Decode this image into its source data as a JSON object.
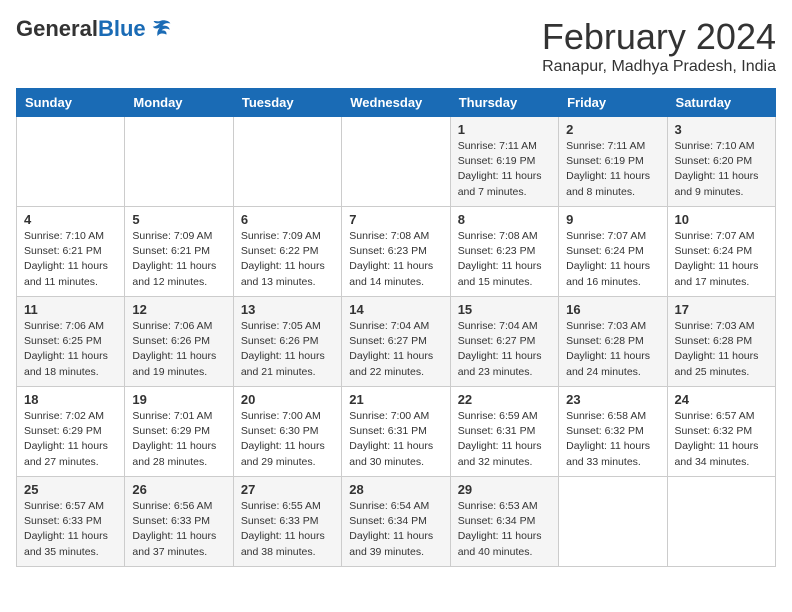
{
  "logo": {
    "general": "General",
    "blue": "Blue"
  },
  "title": "February 2024",
  "subtitle": "Ranapur, Madhya Pradesh, India",
  "days_of_week": [
    "Sunday",
    "Monday",
    "Tuesday",
    "Wednesday",
    "Thursday",
    "Friday",
    "Saturday"
  ],
  "weeks": [
    [
      {
        "day": "",
        "info": ""
      },
      {
        "day": "",
        "info": ""
      },
      {
        "day": "",
        "info": ""
      },
      {
        "day": "",
        "info": ""
      },
      {
        "day": "1",
        "info": "Sunrise: 7:11 AM\nSunset: 6:19 PM\nDaylight: 11 hours and 7 minutes."
      },
      {
        "day": "2",
        "info": "Sunrise: 7:11 AM\nSunset: 6:19 PM\nDaylight: 11 hours and 8 minutes."
      },
      {
        "day": "3",
        "info": "Sunrise: 7:10 AM\nSunset: 6:20 PM\nDaylight: 11 hours and 9 minutes."
      }
    ],
    [
      {
        "day": "4",
        "info": "Sunrise: 7:10 AM\nSunset: 6:21 PM\nDaylight: 11 hours and 11 minutes."
      },
      {
        "day": "5",
        "info": "Sunrise: 7:09 AM\nSunset: 6:21 PM\nDaylight: 11 hours and 12 minutes."
      },
      {
        "day": "6",
        "info": "Sunrise: 7:09 AM\nSunset: 6:22 PM\nDaylight: 11 hours and 13 minutes."
      },
      {
        "day": "7",
        "info": "Sunrise: 7:08 AM\nSunset: 6:23 PM\nDaylight: 11 hours and 14 minutes."
      },
      {
        "day": "8",
        "info": "Sunrise: 7:08 AM\nSunset: 6:23 PM\nDaylight: 11 hours and 15 minutes."
      },
      {
        "day": "9",
        "info": "Sunrise: 7:07 AM\nSunset: 6:24 PM\nDaylight: 11 hours and 16 minutes."
      },
      {
        "day": "10",
        "info": "Sunrise: 7:07 AM\nSunset: 6:24 PM\nDaylight: 11 hours and 17 minutes."
      }
    ],
    [
      {
        "day": "11",
        "info": "Sunrise: 7:06 AM\nSunset: 6:25 PM\nDaylight: 11 hours and 18 minutes."
      },
      {
        "day": "12",
        "info": "Sunrise: 7:06 AM\nSunset: 6:26 PM\nDaylight: 11 hours and 19 minutes."
      },
      {
        "day": "13",
        "info": "Sunrise: 7:05 AM\nSunset: 6:26 PM\nDaylight: 11 hours and 21 minutes."
      },
      {
        "day": "14",
        "info": "Sunrise: 7:04 AM\nSunset: 6:27 PM\nDaylight: 11 hours and 22 minutes."
      },
      {
        "day": "15",
        "info": "Sunrise: 7:04 AM\nSunset: 6:27 PM\nDaylight: 11 hours and 23 minutes."
      },
      {
        "day": "16",
        "info": "Sunrise: 7:03 AM\nSunset: 6:28 PM\nDaylight: 11 hours and 24 minutes."
      },
      {
        "day": "17",
        "info": "Sunrise: 7:03 AM\nSunset: 6:28 PM\nDaylight: 11 hours and 25 minutes."
      }
    ],
    [
      {
        "day": "18",
        "info": "Sunrise: 7:02 AM\nSunset: 6:29 PM\nDaylight: 11 hours and 27 minutes."
      },
      {
        "day": "19",
        "info": "Sunrise: 7:01 AM\nSunset: 6:29 PM\nDaylight: 11 hours and 28 minutes."
      },
      {
        "day": "20",
        "info": "Sunrise: 7:00 AM\nSunset: 6:30 PM\nDaylight: 11 hours and 29 minutes."
      },
      {
        "day": "21",
        "info": "Sunrise: 7:00 AM\nSunset: 6:31 PM\nDaylight: 11 hours and 30 minutes."
      },
      {
        "day": "22",
        "info": "Sunrise: 6:59 AM\nSunset: 6:31 PM\nDaylight: 11 hours and 32 minutes."
      },
      {
        "day": "23",
        "info": "Sunrise: 6:58 AM\nSunset: 6:32 PM\nDaylight: 11 hours and 33 minutes."
      },
      {
        "day": "24",
        "info": "Sunrise: 6:57 AM\nSunset: 6:32 PM\nDaylight: 11 hours and 34 minutes."
      }
    ],
    [
      {
        "day": "25",
        "info": "Sunrise: 6:57 AM\nSunset: 6:33 PM\nDaylight: 11 hours and 35 minutes."
      },
      {
        "day": "26",
        "info": "Sunrise: 6:56 AM\nSunset: 6:33 PM\nDaylight: 11 hours and 37 minutes."
      },
      {
        "day": "27",
        "info": "Sunrise: 6:55 AM\nSunset: 6:33 PM\nDaylight: 11 hours and 38 minutes."
      },
      {
        "day": "28",
        "info": "Sunrise: 6:54 AM\nSunset: 6:34 PM\nDaylight: 11 hours and 39 minutes."
      },
      {
        "day": "29",
        "info": "Sunrise: 6:53 AM\nSunset: 6:34 PM\nDaylight: 11 hours and 40 minutes."
      },
      {
        "day": "",
        "info": ""
      },
      {
        "day": "",
        "info": ""
      }
    ]
  ]
}
